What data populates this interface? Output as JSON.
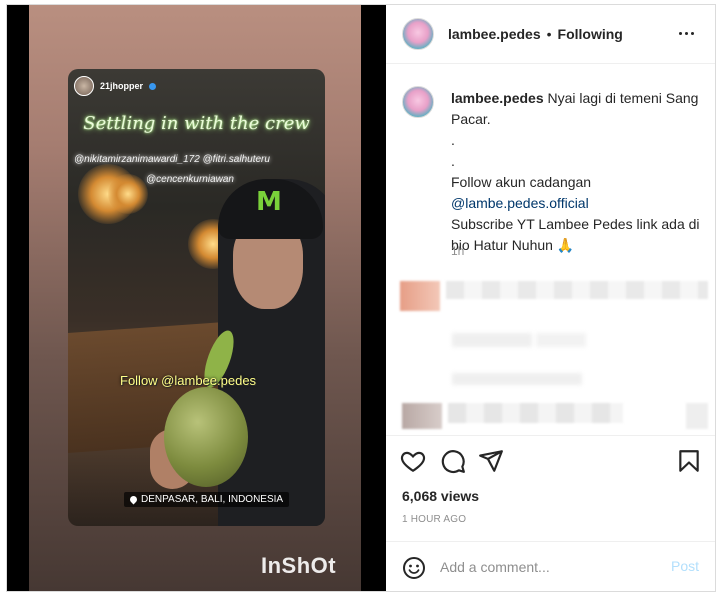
{
  "media": {
    "story": {
      "username": "21jhopper",
      "caption": "Settling in with the crew",
      "tags_line1": "@nikitamirzanimawardi_172 @fitri.salhuteru",
      "tags_line2": "@cencenkurniawan",
      "follow_sticker": "Follow @lambee.pedes",
      "location": "DENPASAR, BALI, INDONESIA"
    },
    "watermark": "InShOt"
  },
  "post": {
    "username": "lambee.pedes",
    "separator": "•",
    "follow_status": "Following",
    "caption": {
      "username": "lambee.pedes",
      "line1": "Nyai lagi di temeni Sang Pacar.",
      "dot1": ".",
      "dot2": ".",
      "line2": "Follow akun cadangan",
      "link": "@lambe.pedes.official",
      "line3": "Subscribe YT Lambee Pedes link ada di bio Hatur Nuhun 🙏",
      "time": "1h"
    },
    "views": "6,068 views",
    "posted_ago": "1 HOUR AGO",
    "comment": {
      "placeholder": "Add a comment...",
      "post_label": "Post"
    }
  },
  "icons": {
    "more": "more-options-icon",
    "like": "heart-icon",
    "comment": "comment-icon",
    "share": "paper-plane-icon",
    "save": "bookmark-icon",
    "emoji": "emoji-icon",
    "location": "pin-icon"
  },
  "colors": {
    "link": "#00376b",
    "post_disabled": "#b2dffc",
    "muted": "#8e8e8e"
  }
}
